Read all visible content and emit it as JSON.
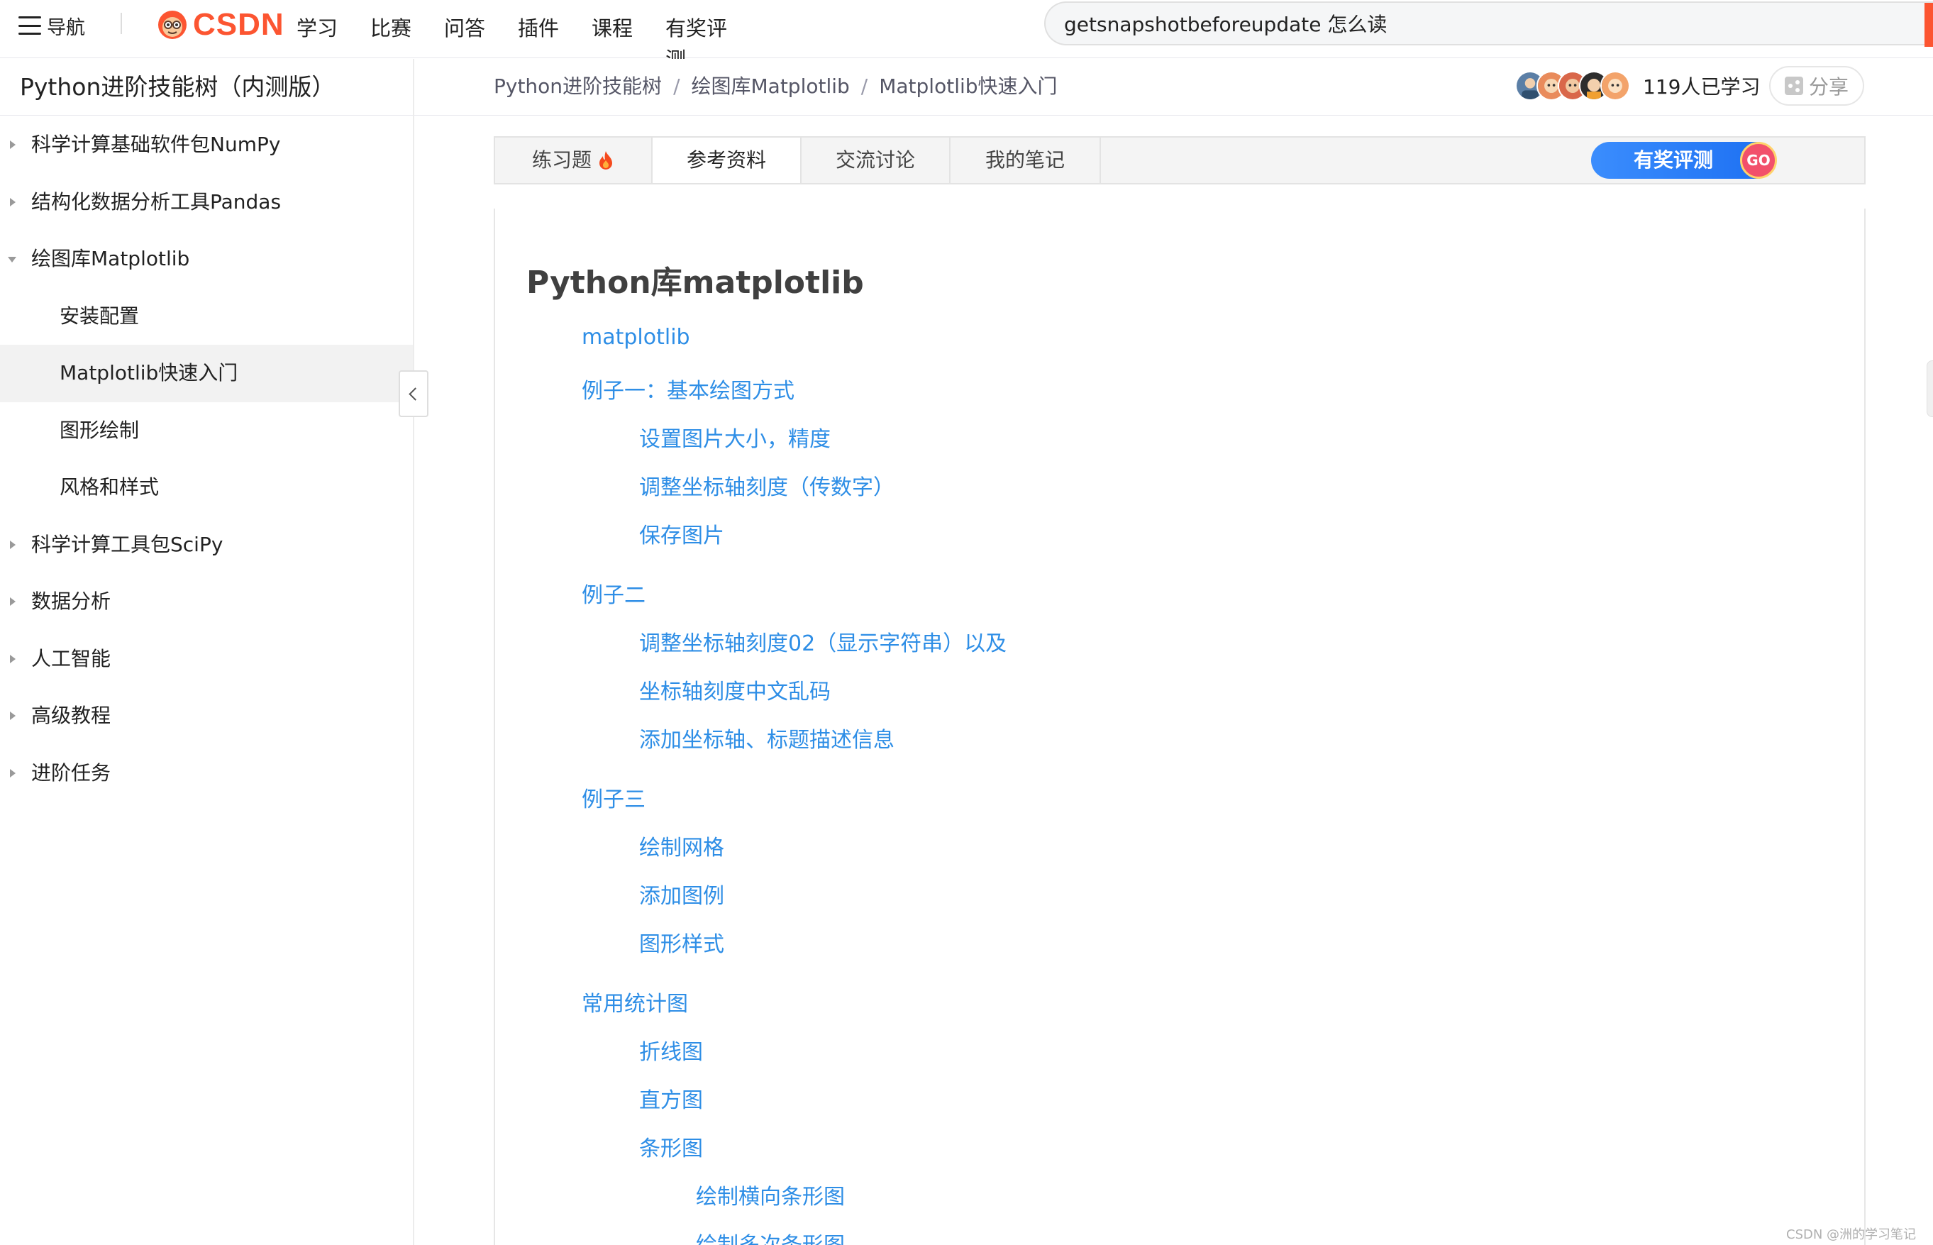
{
  "header": {
    "nav_label": "导航",
    "logo_text": "CSDN",
    "links": [
      "学习",
      "比赛",
      "问答",
      "插件",
      "课程",
      "有奖评测"
    ],
    "search_value": "getsnapshotbeforeupdate 怎么读"
  },
  "subheader": {
    "tree_title": "Python进阶技能树（内测版）",
    "breadcrumb": [
      "Python进阶技能树",
      "绘图库Matplotlib",
      "Matplotlib快速入门"
    ],
    "breadcrumb_sep": "/",
    "learn_count": "119人已学习",
    "share_label": "分享"
  },
  "sidebar": {
    "items": [
      {
        "label": "科学计算基础软件包NumPy",
        "level": 0,
        "state": "collapsed"
      },
      {
        "label": "结构化数据分析工具Pandas",
        "level": 0,
        "state": "collapsed"
      },
      {
        "label": "绘图库Matplotlib",
        "level": 0,
        "state": "expanded"
      },
      {
        "label": "安装配置",
        "level": 1,
        "state": "leaf"
      },
      {
        "label": "Matplotlib快速入门",
        "level": 1,
        "state": "active"
      },
      {
        "label": "图形绘制",
        "level": 1,
        "state": "leaf"
      },
      {
        "label": "风格和样式",
        "level": 1,
        "state": "leaf"
      },
      {
        "label": "科学计算工具包SciPy",
        "level": 0,
        "state": "collapsed"
      },
      {
        "label": "数据分析",
        "level": 0,
        "state": "collapsed"
      },
      {
        "label": "人工智能",
        "level": 0,
        "state": "collapsed"
      },
      {
        "label": "高级教程",
        "level": 0,
        "state": "collapsed"
      },
      {
        "label": "进阶任务",
        "level": 0,
        "state": "collapsed"
      }
    ]
  },
  "tabs": {
    "items": [
      "练习题",
      "参考资料",
      "交流讨论",
      "我的笔记"
    ],
    "active": "参考资料",
    "reward_label": "有奖评测",
    "go_label": "GO"
  },
  "content": {
    "title": "Python库matplotlib",
    "toc": [
      {
        "text": "matplotlib",
        "level": 1
      },
      {
        "text": "例子一：基本绘图方式",
        "level": 1
      },
      {
        "text": "设置图片大小，精度",
        "level": 2
      },
      {
        "text": "调整坐标轴刻度（传数字）",
        "level": 2
      },
      {
        "text": "保存图片",
        "level": 2
      },
      {
        "text": "例子二",
        "level": 1
      },
      {
        "text": "调整坐标轴刻度02（显示字符串）以及",
        "level": 2
      },
      {
        "text": "坐标轴刻度中文乱码",
        "level": 2
      },
      {
        "text": "添加坐标轴、标题描述信息",
        "level": 2
      },
      {
        "text": "例子三",
        "level": 1
      },
      {
        "text": "绘制网格",
        "level": 2
      },
      {
        "text": "添加图例",
        "level": 2
      },
      {
        "text": "图形样式",
        "level": 2
      },
      {
        "text": "常用统计图",
        "level": 1
      },
      {
        "text": "折线图",
        "level": 2
      },
      {
        "text": "直方图",
        "level": 2
      },
      {
        "text": "条形图",
        "level": 2
      },
      {
        "text": "绘制横向条形图",
        "level": 3
      },
      {
        "text": "绘制多次条形图",
        "level": 3
      }
    ]
  },
  "watermark": "CSDN @洲的学习笔记",
  "colors": {
    "brand": "#fc5531",
    "link": "#2e8ee6",
    "reward_blue": "#1c6ff2"
  }
}
